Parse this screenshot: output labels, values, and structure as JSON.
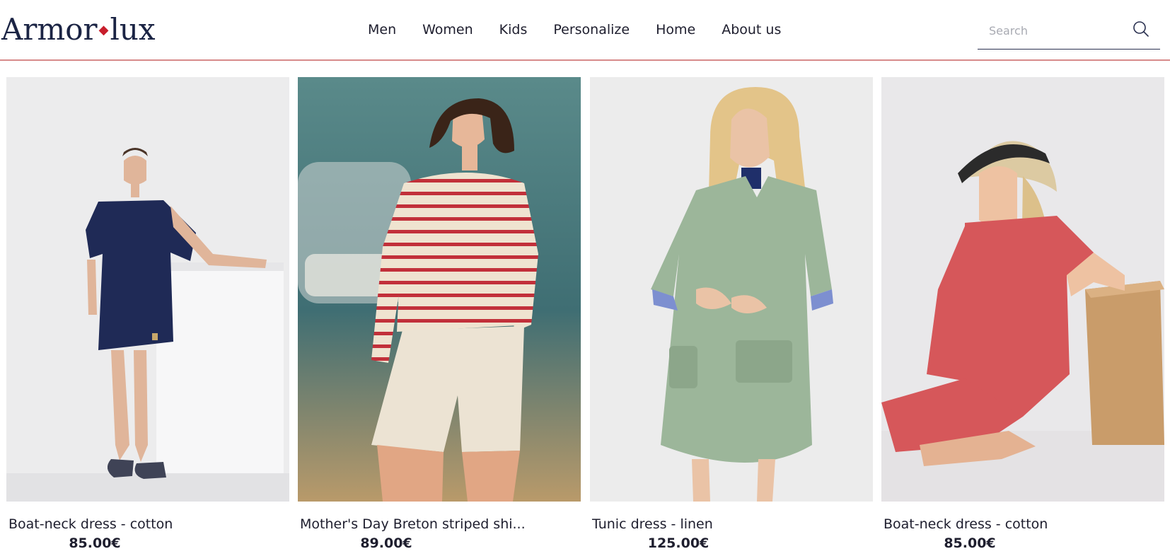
{
  "header": {
    "logo_left": "Armor",
    "logo_dot": "◆",
    "logo_right": "lux",
    "nav": [
      "Men",
      "Women",
      "Kids",
      "Personalize",
      "Home",
      "About us"
    ],
    "search_placeholder": "Search"
  },
  "products": [
    {
      "title": "Boat-neck dress - cotton",
      "price": "85.00€"
    },
    {
      "title": "Mother's Day Breton striped shi...",
      "price": "89.00€"
    },
    {
      "title": "Tunic dress - linen",
      "price": "125.00€"
    },
    {
      "title": "Boat-neck dress - cotton",
      "price": "85.00€"
    }
  ],
  "colors": {
    "logo_accent": "#c81e2c",
    "header_rule": "#d78a8a",
    "text": "#1e1e2e"
  }
}
